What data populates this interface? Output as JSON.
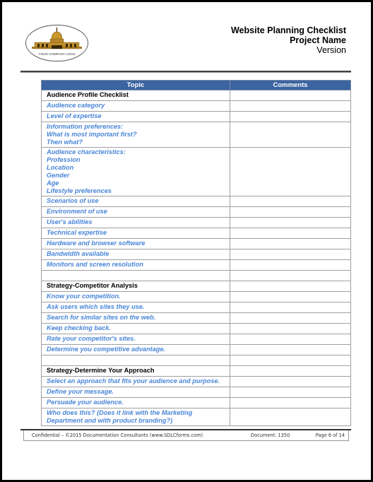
{
  "header": {
    "logo_text": "YOUR COMPANY LOGO",
    "title": "Website Planning Checklist",
    "project": "Project Name",
    "version": "Version"
  },
  "table": {
    "columns": [
      "Topic",
      "Comments"
    ],
    "rows": [
      {
        "type": "section",
        "lines": [
          "Audience Profile Checklist"
        ]
      },
      {
        "type": "item",
        "lines": [
          "Audience category"
        ]
      },
      {
        "type": "item",
        "lines": [
          "Level of expertise"
        ]
      },
      {
        "type": "item",
        "lines": [
          "Information preferences:",
          "What is most important first?",
          "Then what?"
        ]
      },
      {
        "type": "item",
        "lines": [
          "Audience characteristics:",
          "Profession",
          "Location",
          "Gender",
          "Age",
          "Lifestyle preferences"
        ]
      },
      {
        "type": "item",
        "lines": [
          "Scenarios of use"
        ]
      },
      {
        "type": "item",
        "lines": [
          "Environment of use"
        ]
      },
      {
        "type": "item",
        "lines": [
          "User's abilities"
        ]
      },
      {
        "type": "item",
        "lines": [
          "Technical expertise"
        ]
      },
      {
        "type": "item",
        "lines": [
          "Hardware and browser software"
        ]
      },
      {
        "type": "item",
        "lines": [
          "Bandwidth available"
        ]
      },
      {
        "type": "item",
        "lines": [
          "Monitors and screen resolution"
        ]
      },
      {
        "type": "blank",
        "lines": []
      },
      {
        "type": "section",
        "lines": [
          "Strategy-Competitor Analysis"
        ]
      },
      {
        "type": "item",
        "lines": [
          "Know your competition."
        ]
      },
      {
        "type": "item",
        "lines": [
          "Ask users which sites they use."
        ]
      },
      {
        "type": "item",
        "lines": [
          "Search for similar sites on the web."
        ]
      },
      {
        "type": "item",
        "lines": [
          "Keep checking back."
        ]
      },
      {
        "type": "item",
        "lines": [
          "Rate your competitor's sites."
        ]
      },
      {
        "type": "item",
        "lines": [
          "Determine you competitive advantage."
        ]
      },
      {
        "type": "blank",
        "lines": []
      },
      {
        "type": "section",
        "lines": [
          "Strategy-Determine Your Approach"
        ]
      },
      {
        "type": "item",
        "lines": [
          "Select an approach that fits your audience and purpose."
        ]
      },
      {
        "type": "item",
        "lines": [
          "Define your message."
        ]
      },
      {
        "type": "item",
        "lines": [
          "Persuade your audience."
        ]
      },
      {
        "type": "item",
        "lines": [
          "Who does this? (Does it link with the Marketing",
          "Department and with product branding?)"
        ]
      }
    ]
  },
  "footer": {
    "confidential": "Confidential – ©2015 Documentation Consultants (www.SDLCforms.com)",
    "document": "Document: 1350",
    "page": "Page 6 of 14"
  },
  "colors": {
    "header_bg": "#3b64a0",
    "item_text": "#4a86d8",
    "logo_gold": "#b8860b"
  }
}
